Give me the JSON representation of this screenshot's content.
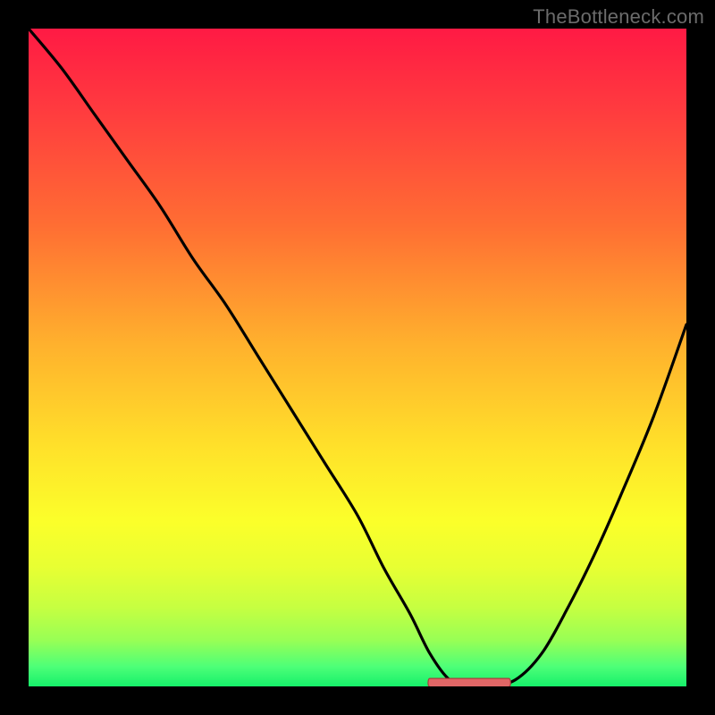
{
  "watermark": "TheBottleneck.com",
  "colors": {
    "background": "#000000",
    "watermark_text": "#6b6b6b",
    "curve_stroke": "#000000",
    "marker_fill": "#e06666",
    "marker_stroke": "#aa3d3d",
    "gradient_stops": [
      "#ff1a44",
      "#ff3a3f",
      "#ff6e33",
      "#ffb12d",
      "#ffe22a",
      "#fbff2a",
      "#e7ff33",
      "#c6ff41",
      "#98ff55",
      "#4dff78",
      "#16f06a"
    ]
  },
  "chart_data": {
    "type": "line",
    "title": "",
    "xlabel": "",
    "ylabel": "",
    "xlim": [
      0,
      100
    ],
    "ylim": [
      0,
      100
    ],
    "grid": false,
    "legend_position": "none",
    "series": [
      {
        "name": "bottleneck-curve",
        "x": [
          0,
          5,
          10,
          15,
          20,
          25,
          30,
          35,
          40,
          45,
          50,
          54,
          58,
          61,
          64,
          67,
          70,
          74,
          78,
          82,
          86,
          90,
          95,
          100
        ],
        "y": [
          100,
          94,
          87,
          80,
          73,
          65,
          58,
          50,
          42,
          34,
          26,
          18,
          11,
          5,
          1,
          0,
          0,
          1,
          5,
          12,
          20,
          29,
          41,
          55
        ]
      }
    ],
    "annotations": [
      {
        "name": "minimum-marker",
        "shape": "flat-segment",
        "x_start": 61,
        "x_end": 73,
        "y": 0.8,
        "color": "#e06666"
      }
    ]
  }
}
